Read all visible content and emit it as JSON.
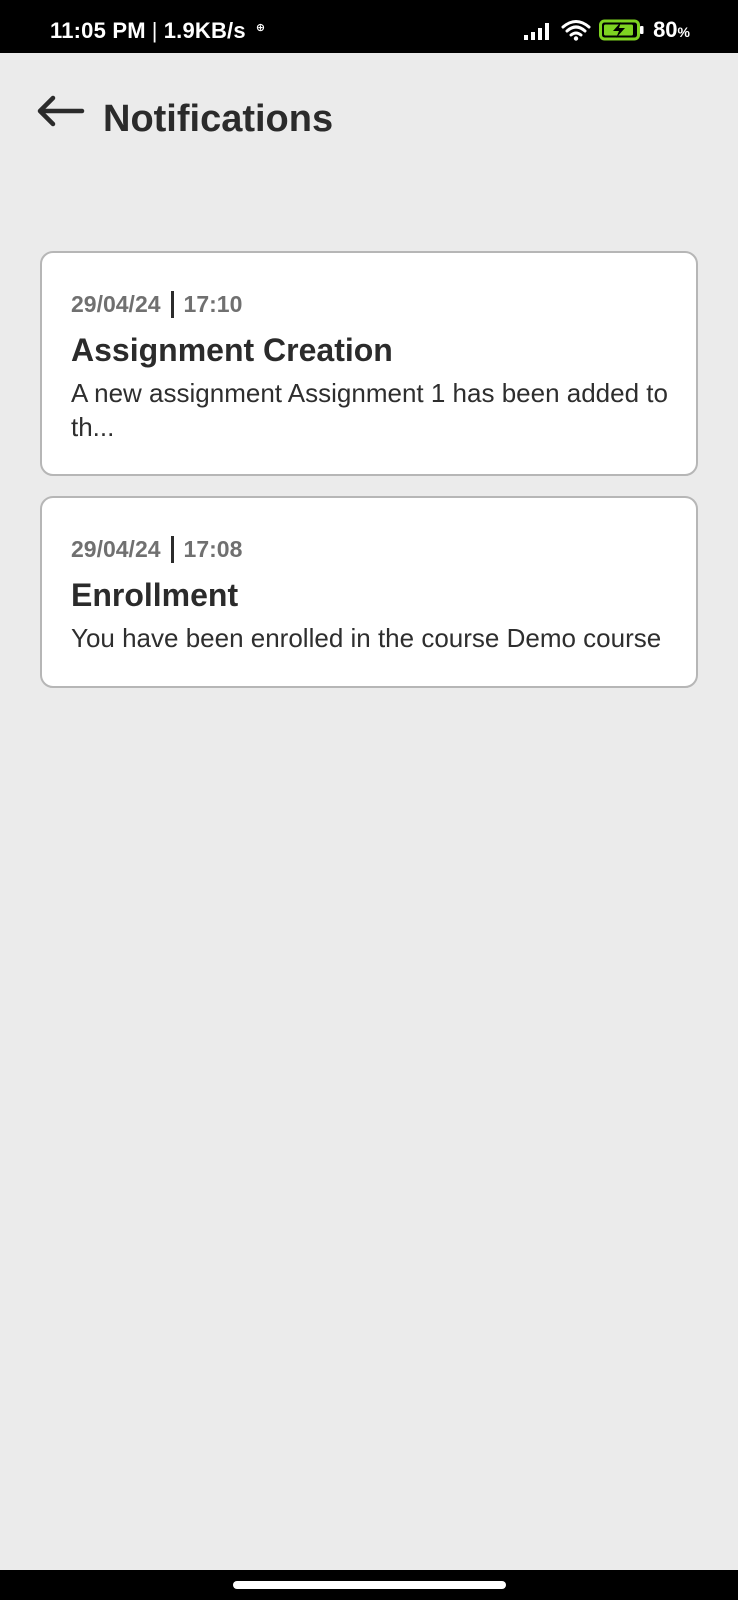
{
  "status_bar": {
    "time": "11:05 PM",
    "separator": "|",
    "speed": "1.9KB/s",
    "sim_indicator": "⊕",
    "battery_percent": "80",
    "battery_unit": "%",
    "icons": [
      "signal-icon",
      "wifi-icon",
      "battery-charging-icon"
    ]
  },
  "header": {
    "title": "Notifications",
    "back_icon": "arrow-left-icon"
  },
  "notifications": [
    {
      "date": "29/04/24",
      "time": "17:10",
      "title": "Assignment Creation",
      "body": "A new assignment Assignment 1 has been added to th..."
    },
    {
      "date": "29/04/24",
      "time": "17:08",
      "title": "Enrollment",
      "body": "You have been enrolled in the course Demo course"
    }
  ],
  "colors": {
    "background": "#ebebeb",
    "card": "#ffffff",
    "card_border": "#b6b6b6",
    "text_primary": "#2b2b2b",
    "text_meta": "#707070",
    "battery_green": "#7ed321"
  }
}
